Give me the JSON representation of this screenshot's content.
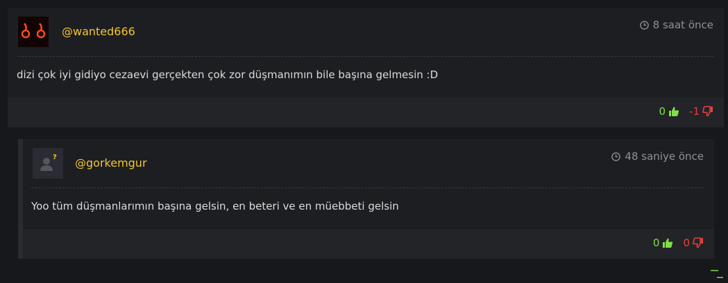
{
  "comments": [
    {
      "username": "@wanted666",
      "time": "8 saat önce",
      "text": "dizi çok iyi gidiyo cezaevi gerçekten çok zor düşmanımın bile başına gelmesin :D",
      "likes": "0",
      "dislikes": "-1",
      "avatar": "demon-eyes-avatar"
    },
    {
      "username": "@gorkemgur",
      "time": "48 saniye önce",
      "text": "Yoo tüm düşmanlarımın başına gelsin, en beteri ve en müebbeti gelsin",
      "likes": "0",
      "dislikes": "0",
      "avatar": "default-user-avatar"
    }
  ],
  "colors": {
    "username": "#f2c534",
    "like": "#7fe04a",
    "dislike": "#e8403a",
    "background": "#16181b",
    "card": "#1d1e21"
  }
}
